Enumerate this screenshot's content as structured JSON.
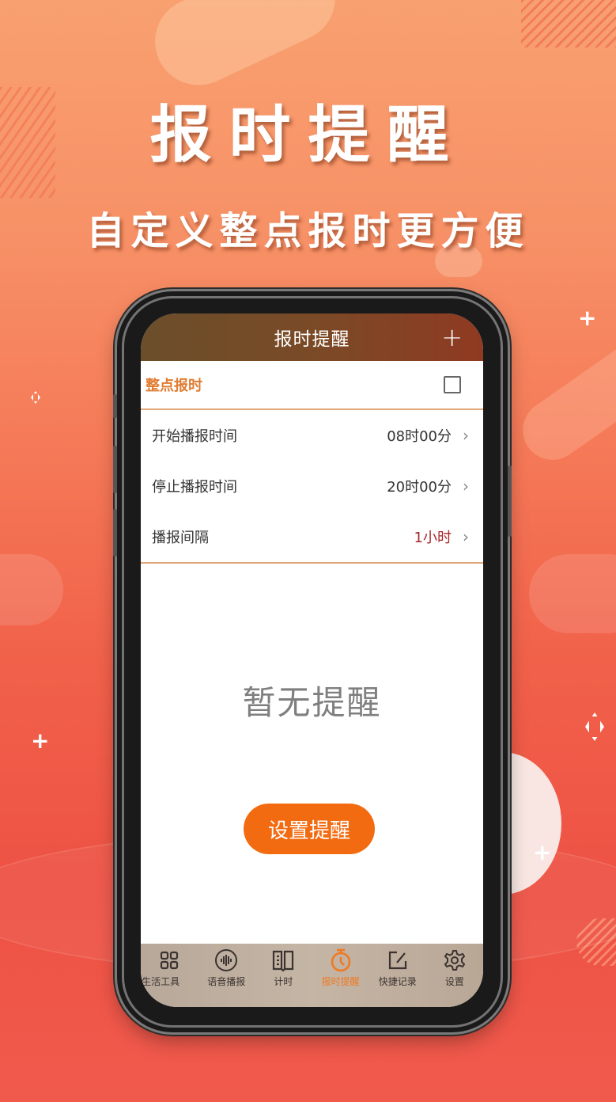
{
  "promo": {
    "headline": "报时提醒",
    "subheadline": "自定义整点报时更方便"
  },
  "app": {
    "title": "报时提醒",
    "add_icon": "plus-icon",
    "hourly_chime": {
      "label": "整点报时",
      "checked": false
    },
    "settings": [
      {
        "label": "开始播报时间",
        "value": "08时00分",
        "accent": false
      },
      {
        "label": "停止播报时间",
        "value": "20时00分",
        "accent": false
      },
      {
        "label": "播报间隔",
        "value": "1小时",
        "accent": true
      }
    ],
    "chevron": "›",
    "empty_state": "暂无提醒",
    "set_reminder_button": "设置提醒",
    "colors": {
      "accent_orange": "#f36b10",
      "label_orange": "#e07b30",
      "value_red": "#a8282a",
      "active_tab": "#f07a22"
    }
  },
  "tabbar": {
    "tabs": [
      {
        "label": "生活工具",
        "icon": "grid-icon",
        "active": false
      },
      {
        "label": "语音播报",
        "icon": "voice-wave-icon",
        "active": false
      },
      {
        "label": "计时",
        "icon": "book-icon",
        "active": false
      },
      {
        "label": "报时提醒",
        "icon": "stopwatch-icon",
        "active": true
      },
      {
        "label": "快捷记录",
        "icon": "edit-note-icon",
        "active": false
      },
      {
        "label": "设置",
        "icon": "gear-icon",
        "active": false
      }
    ]
  }
}
